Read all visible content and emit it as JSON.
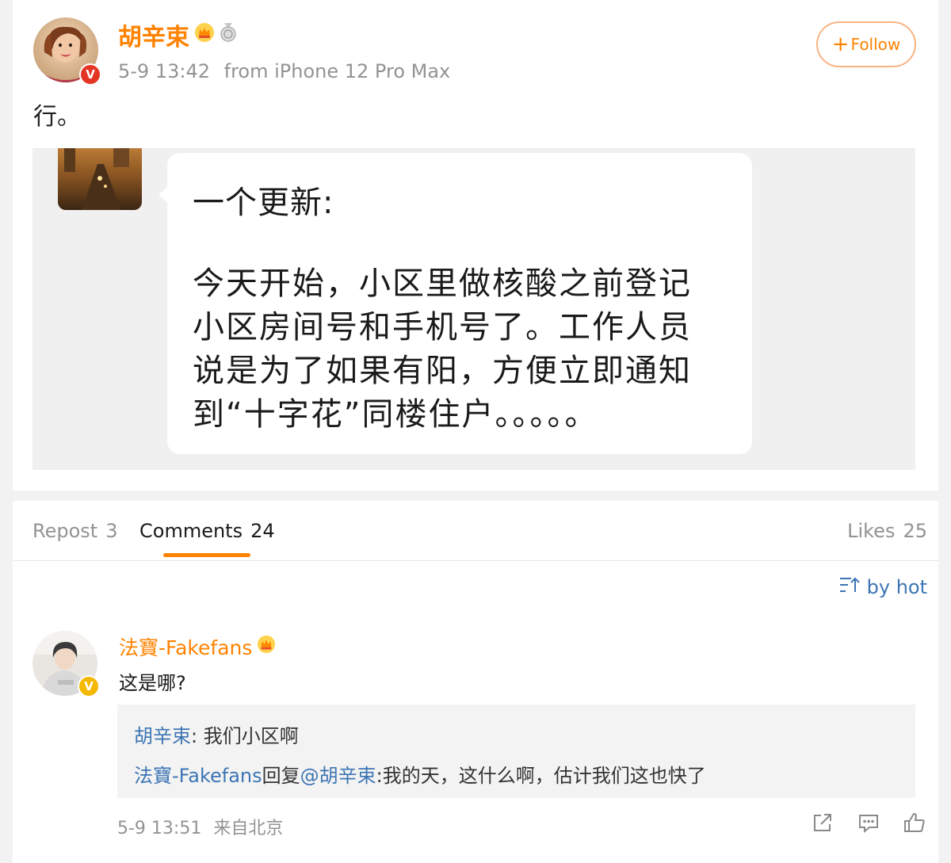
{
  "post": {
    "author": "胡辛束",
    "timestamp": "5-9 13:42",
    "source": "from iPhone 12 Pro Max",
    "follow_label": "Follow",
    "text": "行。",
    "image": {
      "title": "一个更新:",
      "lines": [
        "今天开始，小区里做核酸之前登记",
        "小区房间号和手机号了。工作人员",
        "说是为了如果有阳，方便立即通知",
        "到“十字花”同楼住户。。。。。"
      ]
    }
  },
  "tabs": {
    "repost_label": "Repost",
    "repost_count": "3",
    "comments_label": "Comments",
    "comments_count": "24",
    "likes_label": "Likes",
    "likes_count": "25"
  },
  "sort": {
    "label": "by hot"
  },
  "comment": {
    "author": "法寶-Fakefans",
    "text": "这是哪?",
    "replies": [
      {
        "user": "胡辛束",
        "sep": ": ",
        "text": "我们小区啊"
      },
      {
        "user": "法寶-Fakefans",
        "reply_word": "回复",
        "mention": "@胡辛束",
        "text": ":我的天，这什么啊，估计我们这也快了"
      }
    ],
    "timestamp": "5-9 13:51",
    "location": "来自北京"
  },
  "icons": [
    "crown-icon",
    "medal-icon",
    "plus-icon",
    "sort-icon",
    "share-icon",
    "comment-icon",
    "like-icon",
    "verified-icon"
  ],
  "colors": {
    "accent": "#ff8200",
    "link": "#3d75b5",
    "meta": "#939393",
    "badge_red": "#e43524",
    "badge_yellow": "#f5b800"
  }
}
